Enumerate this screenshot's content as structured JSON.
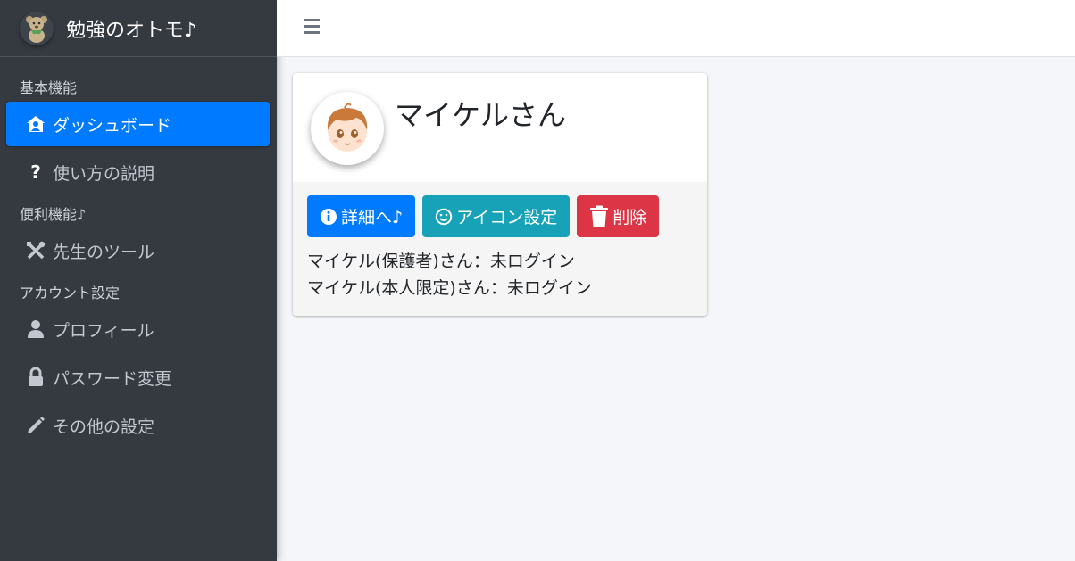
{
  "app": {
    "title": "勉強のオトモ♪"
  },
  "sidebar": {
    "sections": [
      {
        "header": "基本機能",
        "items": [
          {
            "label": "ダッシュボード",
            "icon": "home-user-icon",
            "active": true
          },
          {
            "label": "使い方の説明",
            "icon": "question-icon",
            "active": false
          }
        ]
      },
      {
        "header": "便利機能♪",
        "items": [
          {
            "label": "先生のツール",
            "icon": "tools-icon",
            "active": false
          }
        ]
      },
      {
        "header": "アカウント設定",
        "items": [
          {
            "label": "プロフィール",
            "icon": "user-icon",
            "active": false
          },
          {
            "label": "パスワード変更",
            "icon": "lock-icon",
            "active": false
          },
          {
            "label": "その他の設定",
            "icon": "pencil-icon",
            "active": false
          }
        ]
      }
    ]
  },
  "card": {
    "name": "マイケルさん",
    "buttons": {
      "detail": "詳細へ♪",
      "icon_setting": "アイコン設定",
      "delete": "削除"
    },
    "status_lines": [
      "マイケル(保護者)さん：未ログイン",
      "マイケル(本人限定)さん：未ログイン"
    ]
  },
  "colors": {
    "sidebar_bg": "#343a40",
    "primary": "#007bff",
    "info": "#17a2b8",
    "danger": "#dc3545"
  }
}
